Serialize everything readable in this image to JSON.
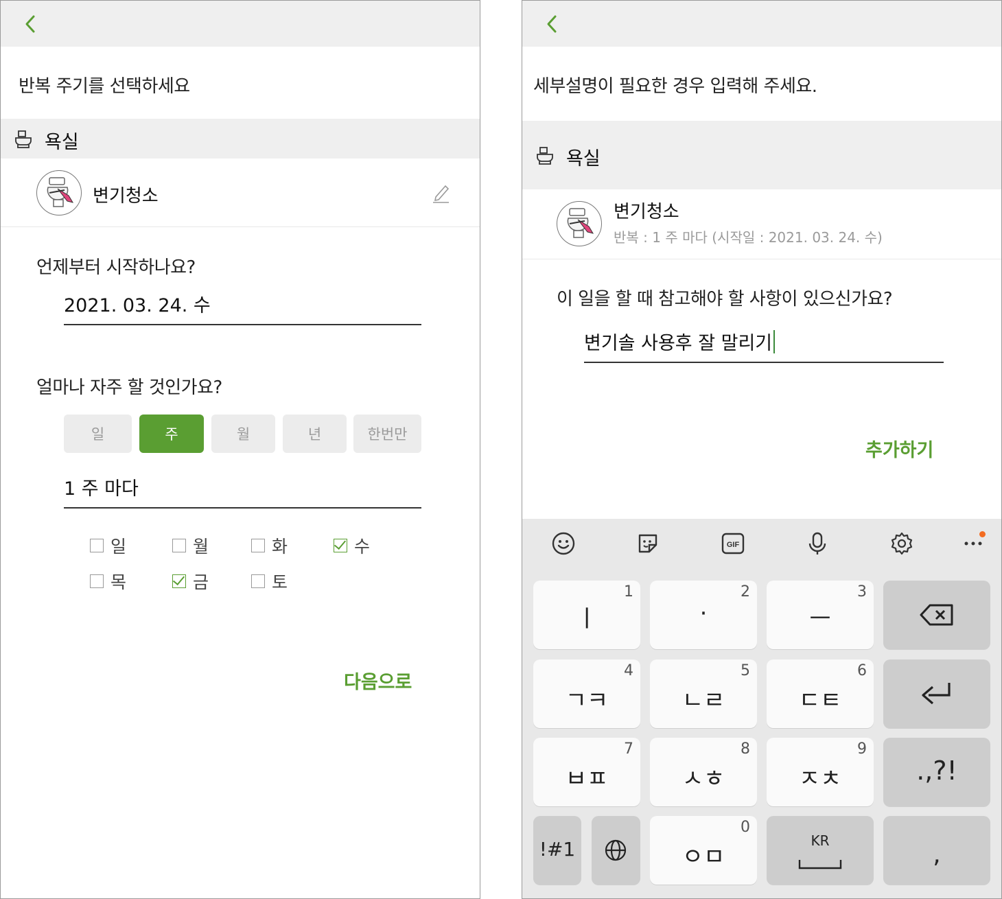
{
  "left": {
    "prompt": "반복 주기를 선택하세요",
    "section": "욕실",
    "task_name": "변기청소",
    "start_question": "언제부터 시작하나요?",
    "start_date": "2021. 03. 24. 수",
    "freq_question": "얼마나 자주 할 것인가요?",
    "segments": [
      {
        "label": "일",
        "active": false
      },
      {
        "label": "주",
        "active": true
      },
      {
        "label": "월",
        "active": false
      },
      {
        "label": "년",
        "active": false
      },
      {
        "label": "한번만",
        "active": false
      }
    ],
    "interval": "1 주 마다",
    "days": [
      {
        "label": "일",
        "checked": false
      },
      {
        "label": "월",
        "checked": false
      },
      {
        "label": "화",
        "checked": false
      },
      {
        "label": "수",
        "checked": true
      },
      {
        "label": "목",
        "checked": false
      },
      {
        "label": "금",
        "checked": true
      },
      {
        "label": "토",
        "checked": false
      }
    ],
    "next_button": "다음으로"
  },
  "right": {
    "prompt": "세부설명이 필요한 경우 입력해 주세요.",
    "section": "욕실",
    "task_name": "변기청소",
    "repeat_info": "반복 : 1 주 마다 (시작일 : 2021. 03. 24. 수)",
    "question": "이 일을 할 때 참고해야 할 사항이 있으신가요?",
    "note_value": "변기솔 사용후 잘 말리기",
    "add_button": "추가하기"
  },
  "keyboard": {
    "tools": [
      "emoji-icon",
      "sticker-icon",
      "gif-icon",
      "microphone-icon",
      "settings-icon",
      "more-icon"
    ],
    "gif_label": "GIF",
    "rows": [
      [
        {
          "glyph": "ㅣ",
          "num": "1"
        },
        {
          "glyph": "·",
          "num": "2"
        },
        {
          "glyph": "ㅡ",
          "num": "3"
        }
      ],
      [
        {
          "glyph": "ㄱㅋ",
          "num": "4"
        },
        {
          "glyph": "ㄴㄹ",
          "num": "5"
        },
        {
          "glyph": "ㄷㅌ",
          "num": "6"
        }
      ],
      [
        {
          "glyph": "ㅂㅍ",
          "num": "7"
        },
        {
          "glyph": "ㅅㅎ",
          "num": "8"
        },
        {
          "glyph": "ㅈㅊ",
          "num": "9"
        }
      ]
    ],
    "punct_key": ".,?!",
    "symbols_key": "!#1",
    "zero_key": {
      "glyph": "ㅇㅁ",
      "num": "0"
    },
    "space_label": "KR",
    "comma_key": ","
  },
  "colors": {
    "accent": "#5a9e32",
    "topbar": "#efefef",
    "keyboard_bg": "#e8e8e8",
    "badge": "#f36c21"
  }
}
